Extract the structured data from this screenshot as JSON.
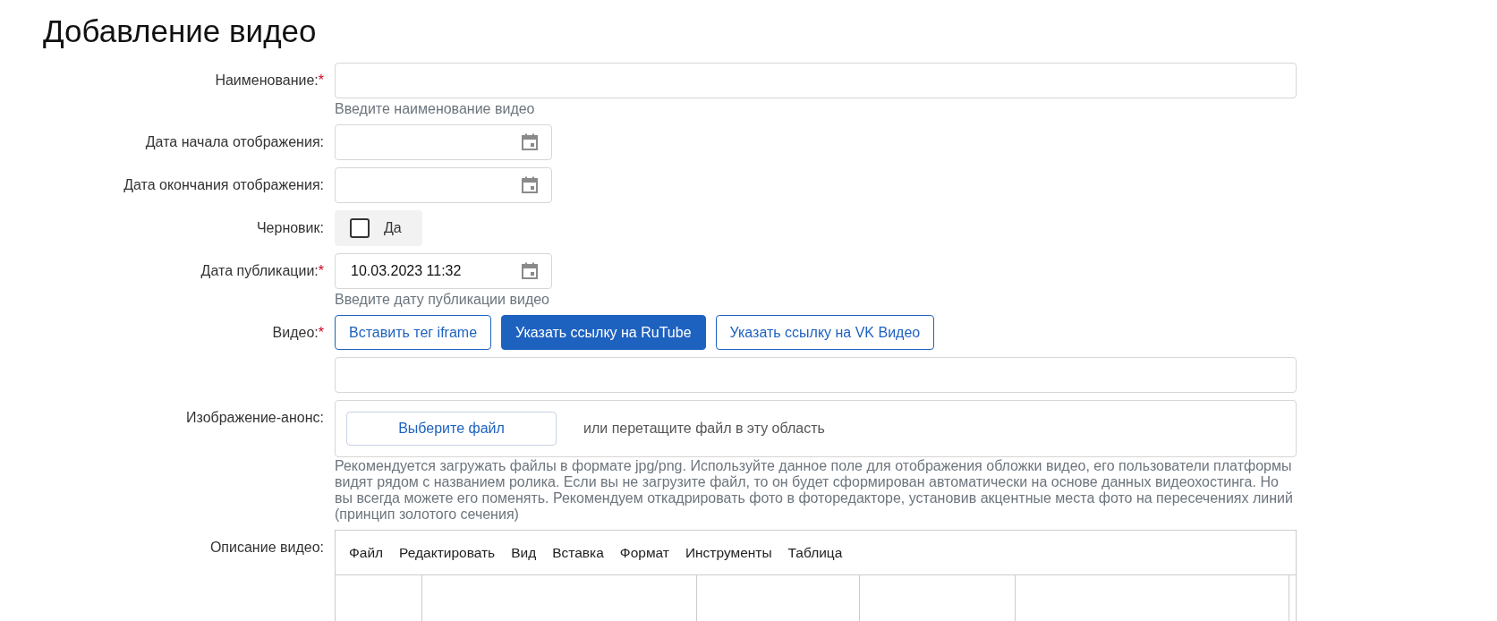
{
  "title": "Добавление видео",
  "fields": [
    {
      "kind": "text",
      "label": "Наименование:",
      "required_mark": "*",
      "hint": "Введите наименование видео"
    },
    {
      "kind": "date",
      "label": "Дата начала отображения:"
    },
    {
      "kind": "date",
      "label": "Дата окончания отображения:"
    },
    {
      "kind": "checkbox",
      "label": "Черновик:",
      "option": "Да",
      "checked": false
    },
    {
      "kind": "date",
      "label": "Дата публикации:",
      "required_mark": "*",
      "value": "10.03.2023 11:32",
      "hint": "Введите дату публикации видео"
    },
    {
      "kind": "video",
      "label": "Видео:",
      "required_mark": "*",
      "sources": [
        {
          "label": "Вставить тег iframe",
          "selected": false
        },
        {
          "label": "Указать ссылку на RuTube",
          "selected": true
        },
        {
          "label": "Указать ссылку на VK Видео",
          "selected": false
        }
      ]
    },
    {
      "kind": "file",
      "label": "Изображение-анонс:",
      "button": "Выберите файл",
      "drop_text": "или перетащите файл в эту область",
      "hint": "Рекомендуется загружать файлы в формате jpg/png. Используйте данное поле для отображения обложки видео, его пользователи платформы видят рядом с названием ролика. Если вы не загрузите файл, то он будет сформирован автоматически на основе данных видеохостинга. Но вы всегда можете его поменять. Рекомендуем откадрировать фото в фоторедакторе, установив акцентные места фото на пересечениях линий (принцип золотого сечения)"
    },
    {
      "kind": "editor",
      "label": "Описание видео:",
      "menu": [
        "Файл",
        "Редактировать",
        "Вид",
        "Вставка",
        "Формат",
        "Инструменты",
        "Таблица"
      ]
    }
  ]
}
